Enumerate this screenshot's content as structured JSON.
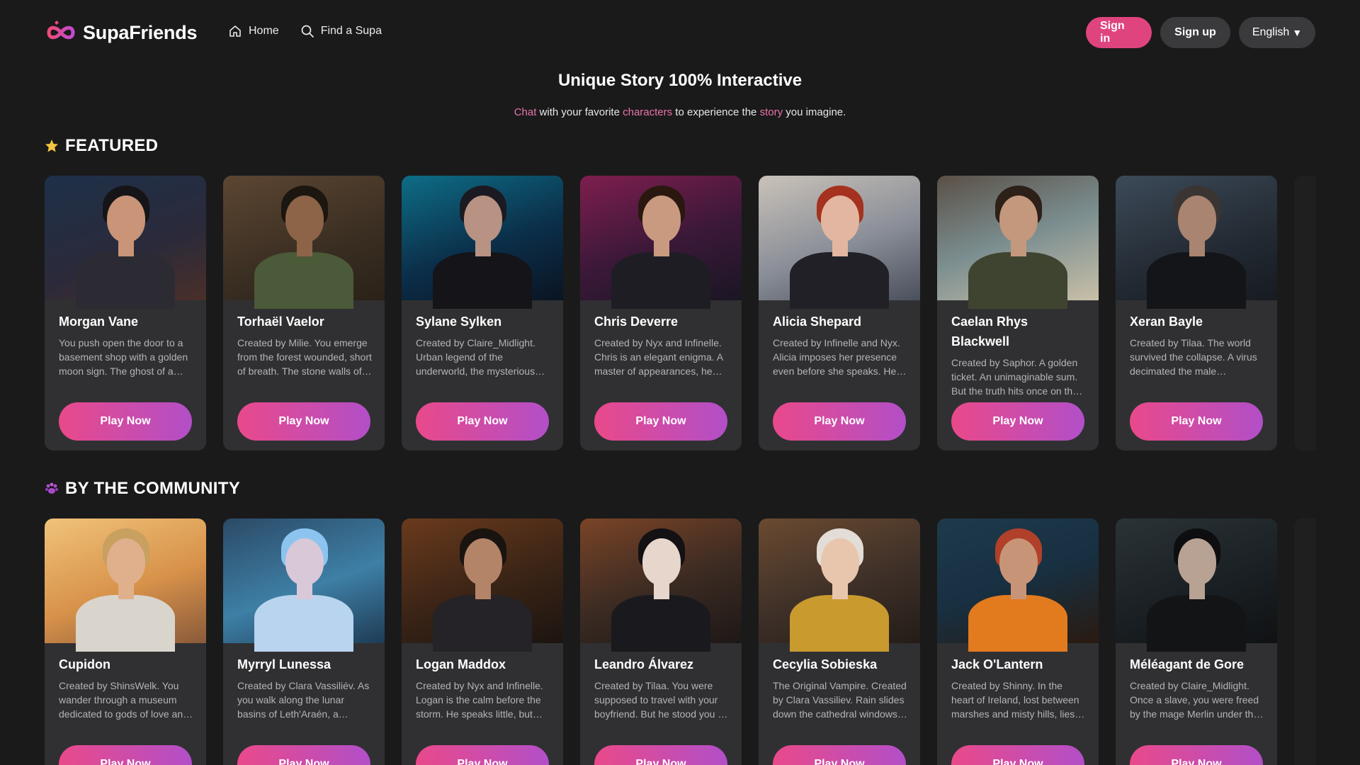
{
  "header": {
    "brand": "SupaFriends",
    "nav": [
      {
        "label": "Home",
        "icon": "home-icon"
      },
      {
        "label": "Find a Supa",
        "icon": "search-icon"
      }
    ],
    "sign_in": "Sign in",
    "sign_up": "Sign up",
    "language": "English"
  },
  "hero": {
    "title": "Unique Story 100% Interactive",
    "sub_w1": "Chat",
    "sub_t1": " with your favorite ",
    "sub_w2": "characters",
    "sub_t2": " to experience the ",
    "sub_w3": "story",
    "sub_t3": " you imagine."
  },
  "featured": {
    "title": "FEATURED",
    "icon": "star-icon",
    "cards": [
      {
        "name": "Morgan Vane",
        "desc": "You push open the door to a basement shop with a golden moon sign. The ghost of a long-lost family stands at the counter.",
        "play": "Play Now"
      },
      {
        "name": "Torhaël Vaelor",
        "desc": "Created by Milie. You emerge from the forest wounded, short of breath. The stone walls of the fortress rise before you.",
        "play": "Play Now"
      },
      {
        "name": "Sylane Sylken",
        "desc": "Created by Claire_Midlight. Urban legend of the underworld, the mysterious biker rules the night streets.",
        "play": "Play Now"
      },
      {
        "name": "Chris Deverre",
        "desc": "Created by Nyx and Infinelle. Chris is an elegant enigma. A master of appearances, he always gets what he wants.",
        "play": "Play Now"
      },
      {
        "name": "Alicia Shepard",
        "desc": "Created by Infinelle and Nyx. Alicia imposes her presence even before she speaks. Her gaze cuts through the room.",
        "play": "Play Now"
      },
      {
        "name": "Caelan Rhys Blackwell",
        "desc": "Created by Saphor. A golden ticket. An unimaginable sum. But the truth hits once on the island shore.",
        "play": "Play Now"
      },
      {
        "name": "Xeran Bayle",
        "desc": "Created by Tilaa. The world survived the collapse. A virus decimated the male population long ago.",
        "play": "Play Now"
      }
    ]
  },
  "community": {
    "title": "BY THE COMMUNITY",
    "icon": "paw-icon",
    "cards": [
      {
        "name": "Cupidon",
        "desc": "Created by ShinsWelk. You wander through a museum dedicated to gods of love and beauty at dusk.",
        "play": "Play Now"
      },
      {
        "name": "Myrryl Lunessa",
        "desc": "Created by Clara Vassiliév. As you walk along the lunar basins of Leth'Araén, a melody rises.",
        "play": "Play Now"
      },
      {
        "name": "Logan Maddox",
        "desc": "Created by Nyx and Infinelle. Logan is the calm before the storm. He speaks little, but watches everything.",
        "play": "Play Now"
      },
      {
        "name": "Leandro Álvarez",
        "desc": "Created by Tilaa. You were supposed to travel with your boyfriend. But he stood you up at the last minute.",
        "play": "Play Now"
      },
      {
        "name": "Cecylia Sobieska",
        "desc": "The Original Vampire. Created by Clara Vassiliev. Rain slides down the cathedral windows tonight.",
        "play": "Play Now"
      },
      {
        "name": "Jack O'Lantern",
        "desc": "Created by Shinny. In the heart of Ireland, lost between marshes and misty hills, lies a village.",
        "play": "Play Now"
      },
      {
        "name": "Méléagant de Gore",
        "desc": "Created by Claire_Midlight. Once a slave, you were freed by the mage Merlin under the old oaks.",
        "play": "Play Now"
      }
    ]
  },
  "colors": {
    "background": "#1a1a1b",
    "card": "#303032",
    "accent": "#e0447f",
    "accent_gradient_end": "#b24fc8",
    "highlight_text": "#e974a8"
  }
}
